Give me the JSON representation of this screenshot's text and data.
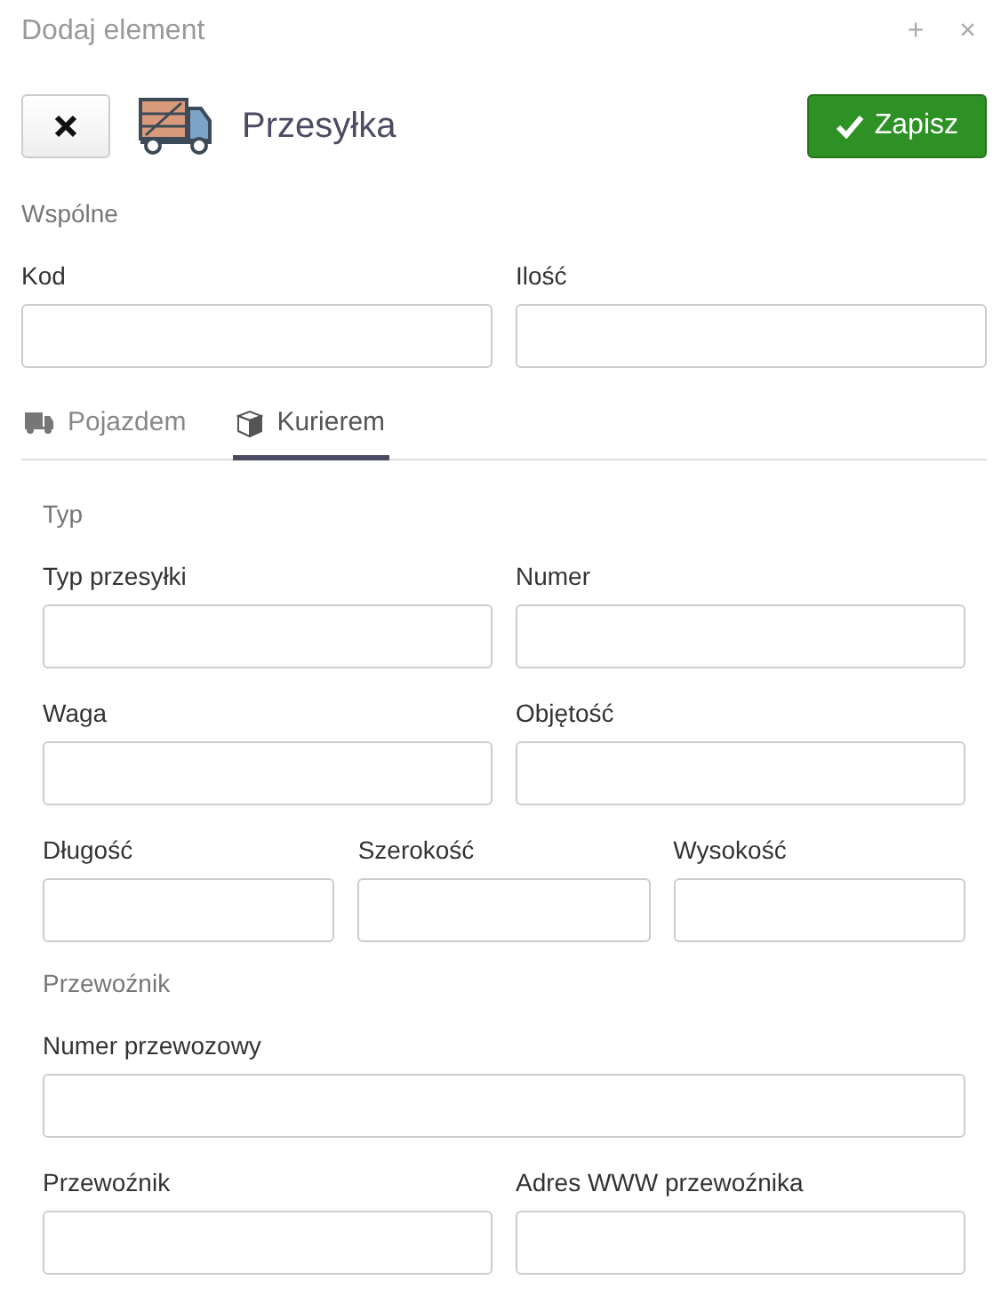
{
  "window": {
    "title": "Dodaj element",
    "actions": [
      "+",
      "×"
    ]
  },
  "toolbar": {
    "title": "Przesyłka",
    "save": "Zapisz"
  },
  "common": {
    "heading": "Wspólne",
    "rows": [
      [
        {
          "label": "Kod"
        },
        {
          "label": "Ilość"
        }
      ]
    ]
  },
  "tabs": [
    {
      "label": "Pojazdem",
      "kind": "truck",
      "selected": false
    },
    {
      "label": "Kurierem",
      "kind": "box",
      "selected": true
    }
  ],
  "sections": [
    {
      "heading": "Typ",
      "rows": [
        [
          {
            "label": "Typ przesyłki"
          },
          {
            "label": "Numer"
          }
        ],
        [
          {
            "label": "Waga"
          },
          {
            "label": "Objętość"
          }
        ],
        [
          {
            "label": "Długość"
          },
          {
            "label": "Szerokość"
          },
          {
            "label": "Wysokość"
          }
        ]
      ]
    },
    {
      "heading": "Przewoźnik",
      "rows": [
        [
          {
            "label": "Numer przewozowy"
          }
        ],
        [
          {
            "label": "Przewoźnik"
          },
          {
            "label": "Adres WWW przewoźnika"
          }
        ]
      ]
    }
  ]
}
